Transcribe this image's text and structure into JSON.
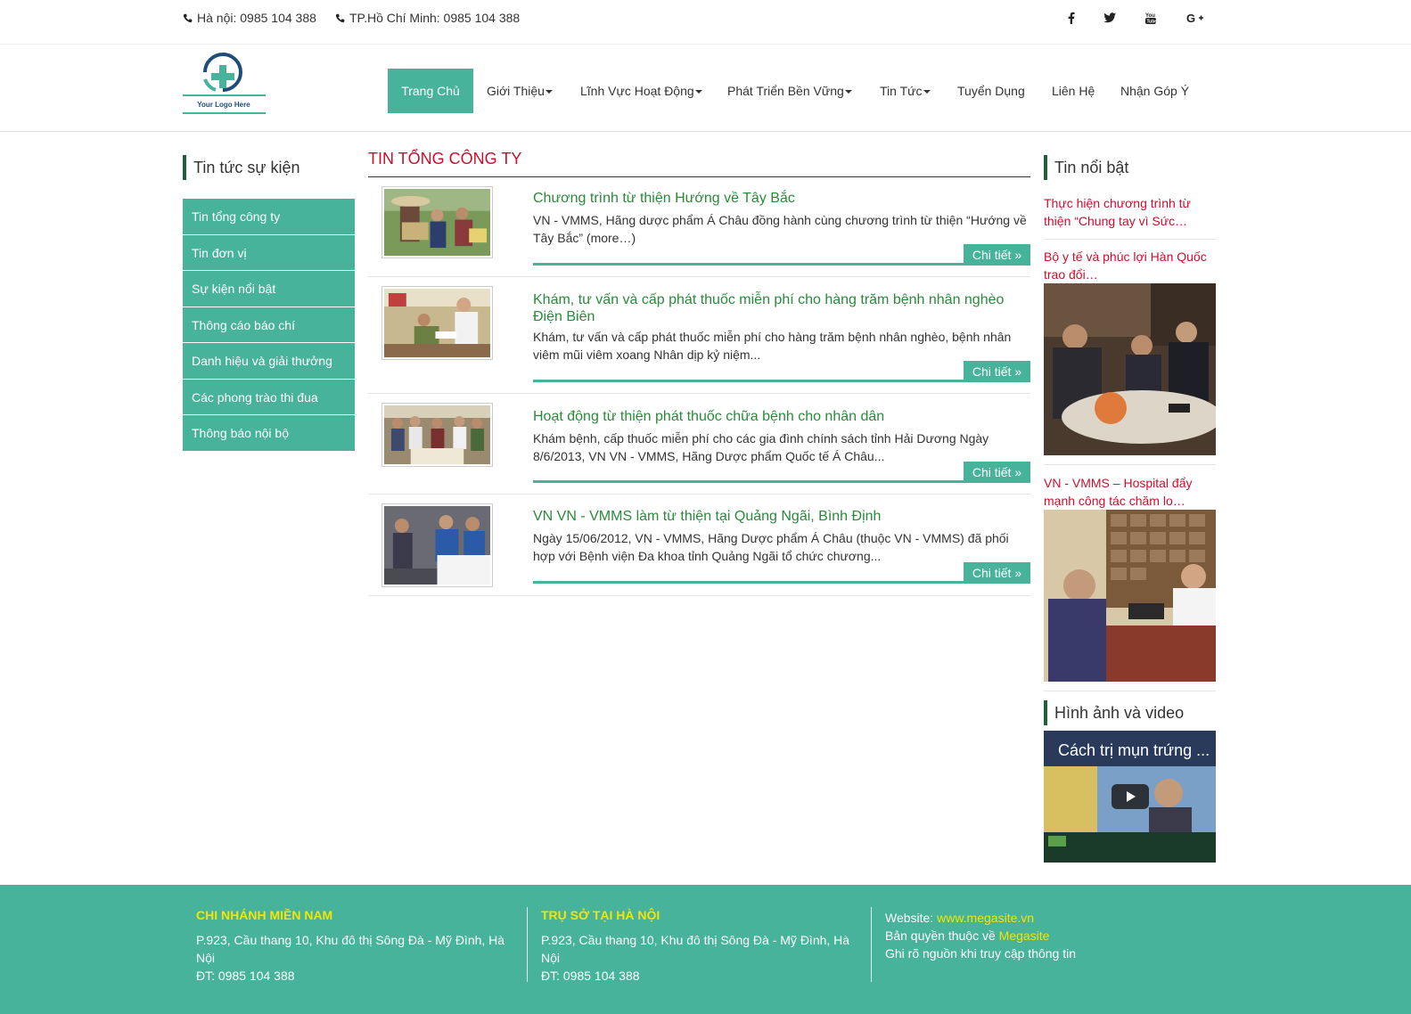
{
  "topbar": {
    "contacts": [
      {
        "label": "Hà nội: 0985 104 388"
      },
      {
        "label": "TP.Hồ Chí Minh: 0985 104 388"
      }
    ],
    "social": [
      "facebook-icon",
      "twitter-icon",
      "youtube-icon",
      "google-plus-icon"
    ]
  },
  "header": {
    "logo_text": "Your Logo Here",
    "nav": [
      {
        "label": "Trang Chủ",
        "active": true,
        "dropdown": false
      },
      {
        "label": "Giới Thiệu",
        "dropdown": true
      },
      {
        "label": "Lĩnh Vực Hoạt Động",
        "dropdown": true
      },
      {
        "label": "Phát Triển Bền Vững",
        "dropdown": true
      },
      {
        "label": "Tin Tức",
        "dropdown": true
      },
      {
        "label": "Tuyển Dụng",
        "dropdown": false
      },
      {
        "label": "Liên Hệ",
        "dropdown": false
      },
      {
        "label": "Nhận Góp Ý",
        "dropdown": false
      }
    ]
  },
  "left_sidebar": {
    "title": "Tin tức sự kiện",
    "items": [
      "Tin tổng công ty",
      "Tin đơn vị",
      "Sự kiện nổi bật",
      "Thông cáo báo chí",
      "Danh hiệu và giải thưởng",
      "Các phong trào thi đua",
      "Thông báo nội bộ"
    ]
  },
  "main": {
    "title": "TIN TỔNG CÔNG TY",
    "detail_label": "Chi tiết »",
    "articles": [
      {
        "title": "Chương trình từ thiện Hướng về Tây Bắc",
        "desc": "VN - VMMS, Hãng dược phẩm Á Châu đồng hành cùng chương trình từ thiện “Hướng về Tây Bắc” (more…)"
      },
      {
        "title": "Khám, tư vấn và cấp phát thuốc miễn phí cho hàng trăm bệnh nhân nghèo Điện Biên",
        "desc": "Khám, tư vấn và cấp phát thuốc miễn phí cho hàng trăm bệnh nhân nghèo, bệnh nhân viêm mũi viêm xoang Nhân dịp kỷ niệm..."
      },
      {
        "title": "Hoạt động từ thiện phát thuốc chữa bệnh cho nhân dân",
        "desc": "Khám bệnh, cấp thuốc miễn phí cho các gia đình chính sách tỉnh Hải Dương Ngày 8/6/2013, VN VN - VMMS, Hãng Dược phẩm Quốc tế Á Châu..."
      },
      {
        "title": "VN VN - VMMS làm từ thiện tại Quảng Ngãi, Bình Định",
        "desc": "Ngày 15/06/2012, VN - VMMS, Hãng Dược phẩm Á Châu (thuộc VN - VMMS) đã phối hợp với Bệnh viện Đa khoa tỉnh Quảng Ngãi tổ chức chương..."
      }
    ]
  },
  "right_sidebar": {
    "hot_title": "Tin nổi bật",
    "hot_items": [
      "Thực hiện chương trình từ thiện “Chung tay vì Sức…",
      "Bộ y tế và phúc lợi Hàn Quốc trao đổi…",
      "VN - VMMS – Hospital đẩy mạnh công tác chăm lo…"
    ],
    "media_title": "Hình ảnh và video",
    "video_title": "Cách trị mụn trứng ..."
  },
  "footer": {
    "south": {
      "heading": "CHI NHÁNH MIỀN NAM",
      "address": "P.923, Cầu thang 10, Khu đô thị Sông Đà - Mỹ Đình, Hà Nội",
      "phone": "ĐT: 0985 104 388"
    },
    "hanoi": {
      "heading": "TRỤ SỞ TẠI HÀ NỘI",
      "address": "P.923, Cầu thang 10, Khu đô thị Sông Đà - Mỹ Đình, Hà Nội",
      "phone": "ĐT: 0985 104 388"
    },
    "info": {
      "website_label": "Website:",
      "website": "www.megasite.vn",
      "copyright_label": "Bản quyền thuộc về",
      "copyright_name": "Megasite",
      "note": "Ghi rõ nguồn khi truy cập thông tin"
    }
  }
}
